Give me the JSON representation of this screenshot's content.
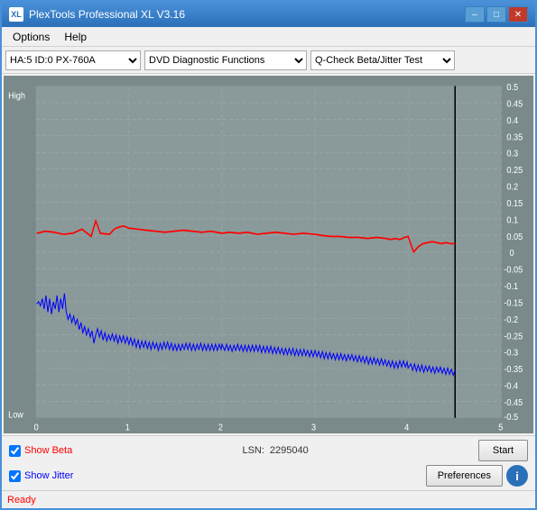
{
  "window": {
    "title": "PlexTools Professional XL V3.16",
    "icon_label": "XL"
  },
  "title_controls": {
    "minimize": "–",
    "maximize": "□",
    "close": "✕"
  },
  "menu": {
    "items": [
      "Options",
      "Help"
    ]
  },
  "toolbar": {
    "drive_select": {
      "value": "HA:5 ID:0  PX-760A",
      "options": [
        "HA:5 ID:0  PX-760A"
      ]
    },
    "function_select": {
      "value": "DVD Diagnostic Functions",
      "options": [
        "DVD Diagnostic Functions"
      ]
    },
    "test_select": {
      "value": "Q-Check Beta/Jitter Test",
      "options": [
        "Q-Check Beta/Jitter Test"
      ]
    }
  },
  "chart": {
    "y_labels_right": [
      "0.5",
      "0.45",
      "0.4",
      "0.35",
      "0.3",
      "0.25",
      "0.2",
      "0.15",
      "0.1",
      "0.05",
      "0",
      "−0.05",
      "−0.1",
      "−0.15",
      "−0.2",
      "−0.25",
      "−0.3",
      "−0.35",
      "−0.4",
      "−0.45",
      "−0.5"
    ],
    "x_labels": [
      "0",
      "1",
      "2",
      "3",
      "4",
      "5"
    ],
    "y_label_high": "High",
    "y_label_low": "Low"
  },
  "controls": {
    "show_beta_label": "Show Beta",
    "show_jitter_label": "Show Jitter",
    "lsn_label": "LSN:",
    "lsn_value": "2295040",
    "start_button": "Start",
    "preferences_button": "Preferences",
    "info_button": "i"
  },
  "status": {
    "text": "Ready"
  }
}
